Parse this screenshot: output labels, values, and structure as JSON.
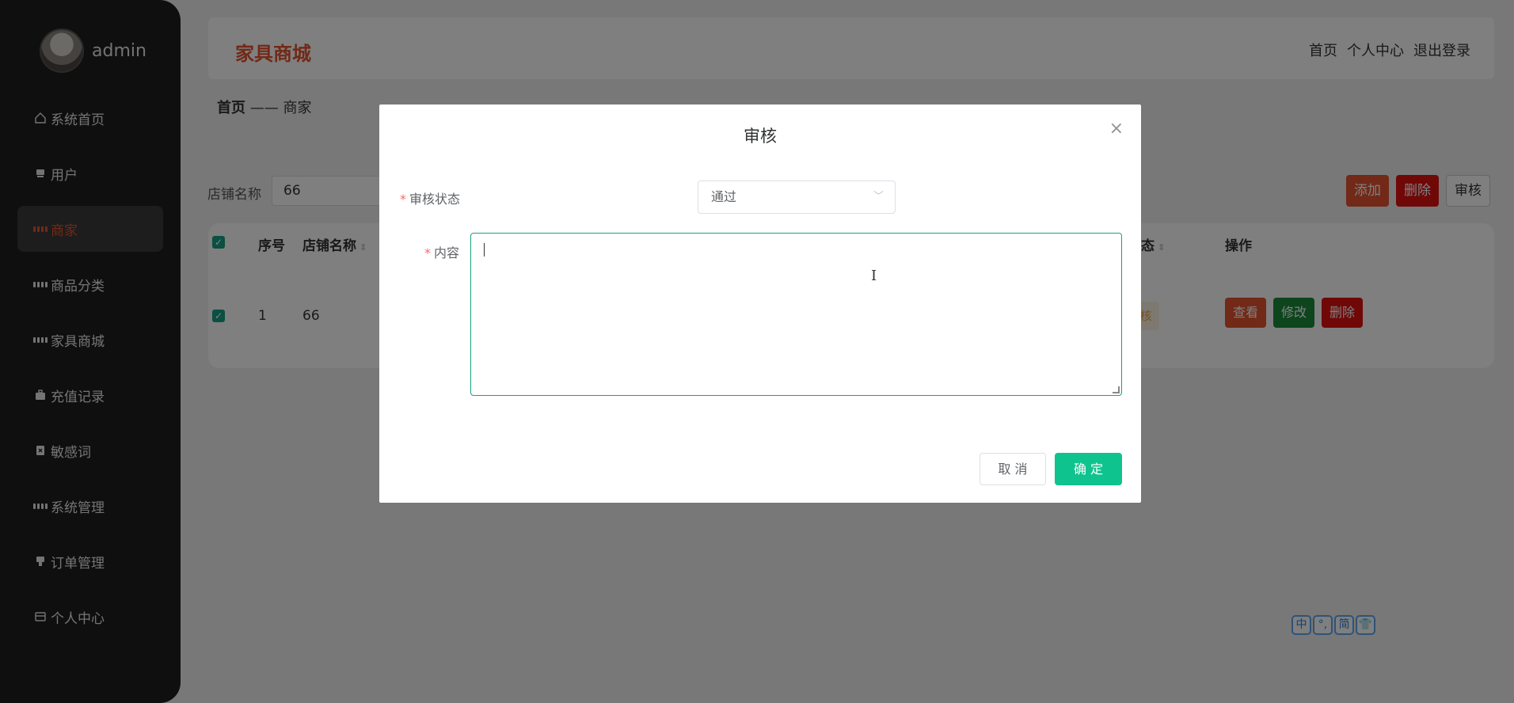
{
  "sidebar": {
    "user": "admin",
    "items": [
      {
        "label": "系统首页",
        "icon": "home-icon"
      },
      {
        "label": "用户",
        "icon": "user-icon"
      },
      {
        "label": "商家",
        "icon": "grid-icon",
        "active": true
      },
      {
        "label": "商品分类",
        "icon": "grid-icon"
      },
      {
        "label": "家具商城",
        "icon": "grid-icon"
      },
      {
        "label": "充值记录",
        "icon": "briefcase-icon"
      },
      {
        "label": "敏感词",
        "icon": "clipboard-icon"
      },
      {
        "label": "系统管理",
        "icon": "grid-icon"
      },
      {
        "label": "订单管理",
        "icon": "stamp-icon"
      },
      {
        "label": "个人中心",
        "icon": "card-icon"
      }
    ]
  },
  "header": {
    "title": "家具商城",
    "links": [
      "首页",
      "个人中心",
      "退出登录"
    ]
  },
  "breadcrumb": {
    "home": "首页",
    "sep": "——",
    "current": "商家"
  },
  "search": {
    "label": "店铺名称",
    "value": "66"
  },
  "toolbar": {
    "add": "添加",
    "delete": "删除",
    "audit": "审核"
  },
  "table": {
    "headers": [
      "序号",
      "店铺名称",
      "态",
      "操作"
    ],
    "rows": [
      {
        "index": "1",
        "name": "66",
        "status": "核"
      }
    ],
    "row_actions": [
      "查看",
      "修改",
      "删除"
    ]
  },
  "dialog": {
    "title": "审核",
    "close": "×",
    "status_label": "审核状态",
    "status_value": "通过",
    "content_label": "内容",
    "required_mark": "*",
    "cancel": "取 消",
    "confirm": "确 定"
  },
  "ime": [
    "中",
    "°,",
    "简",
    "👕"
  ],
  "colors": {
    "accent": "#e4522f",
    "primary": "#0fc38f",
    "danger": "#e01010",
    "success": "#1b8a3b"
  }
}
